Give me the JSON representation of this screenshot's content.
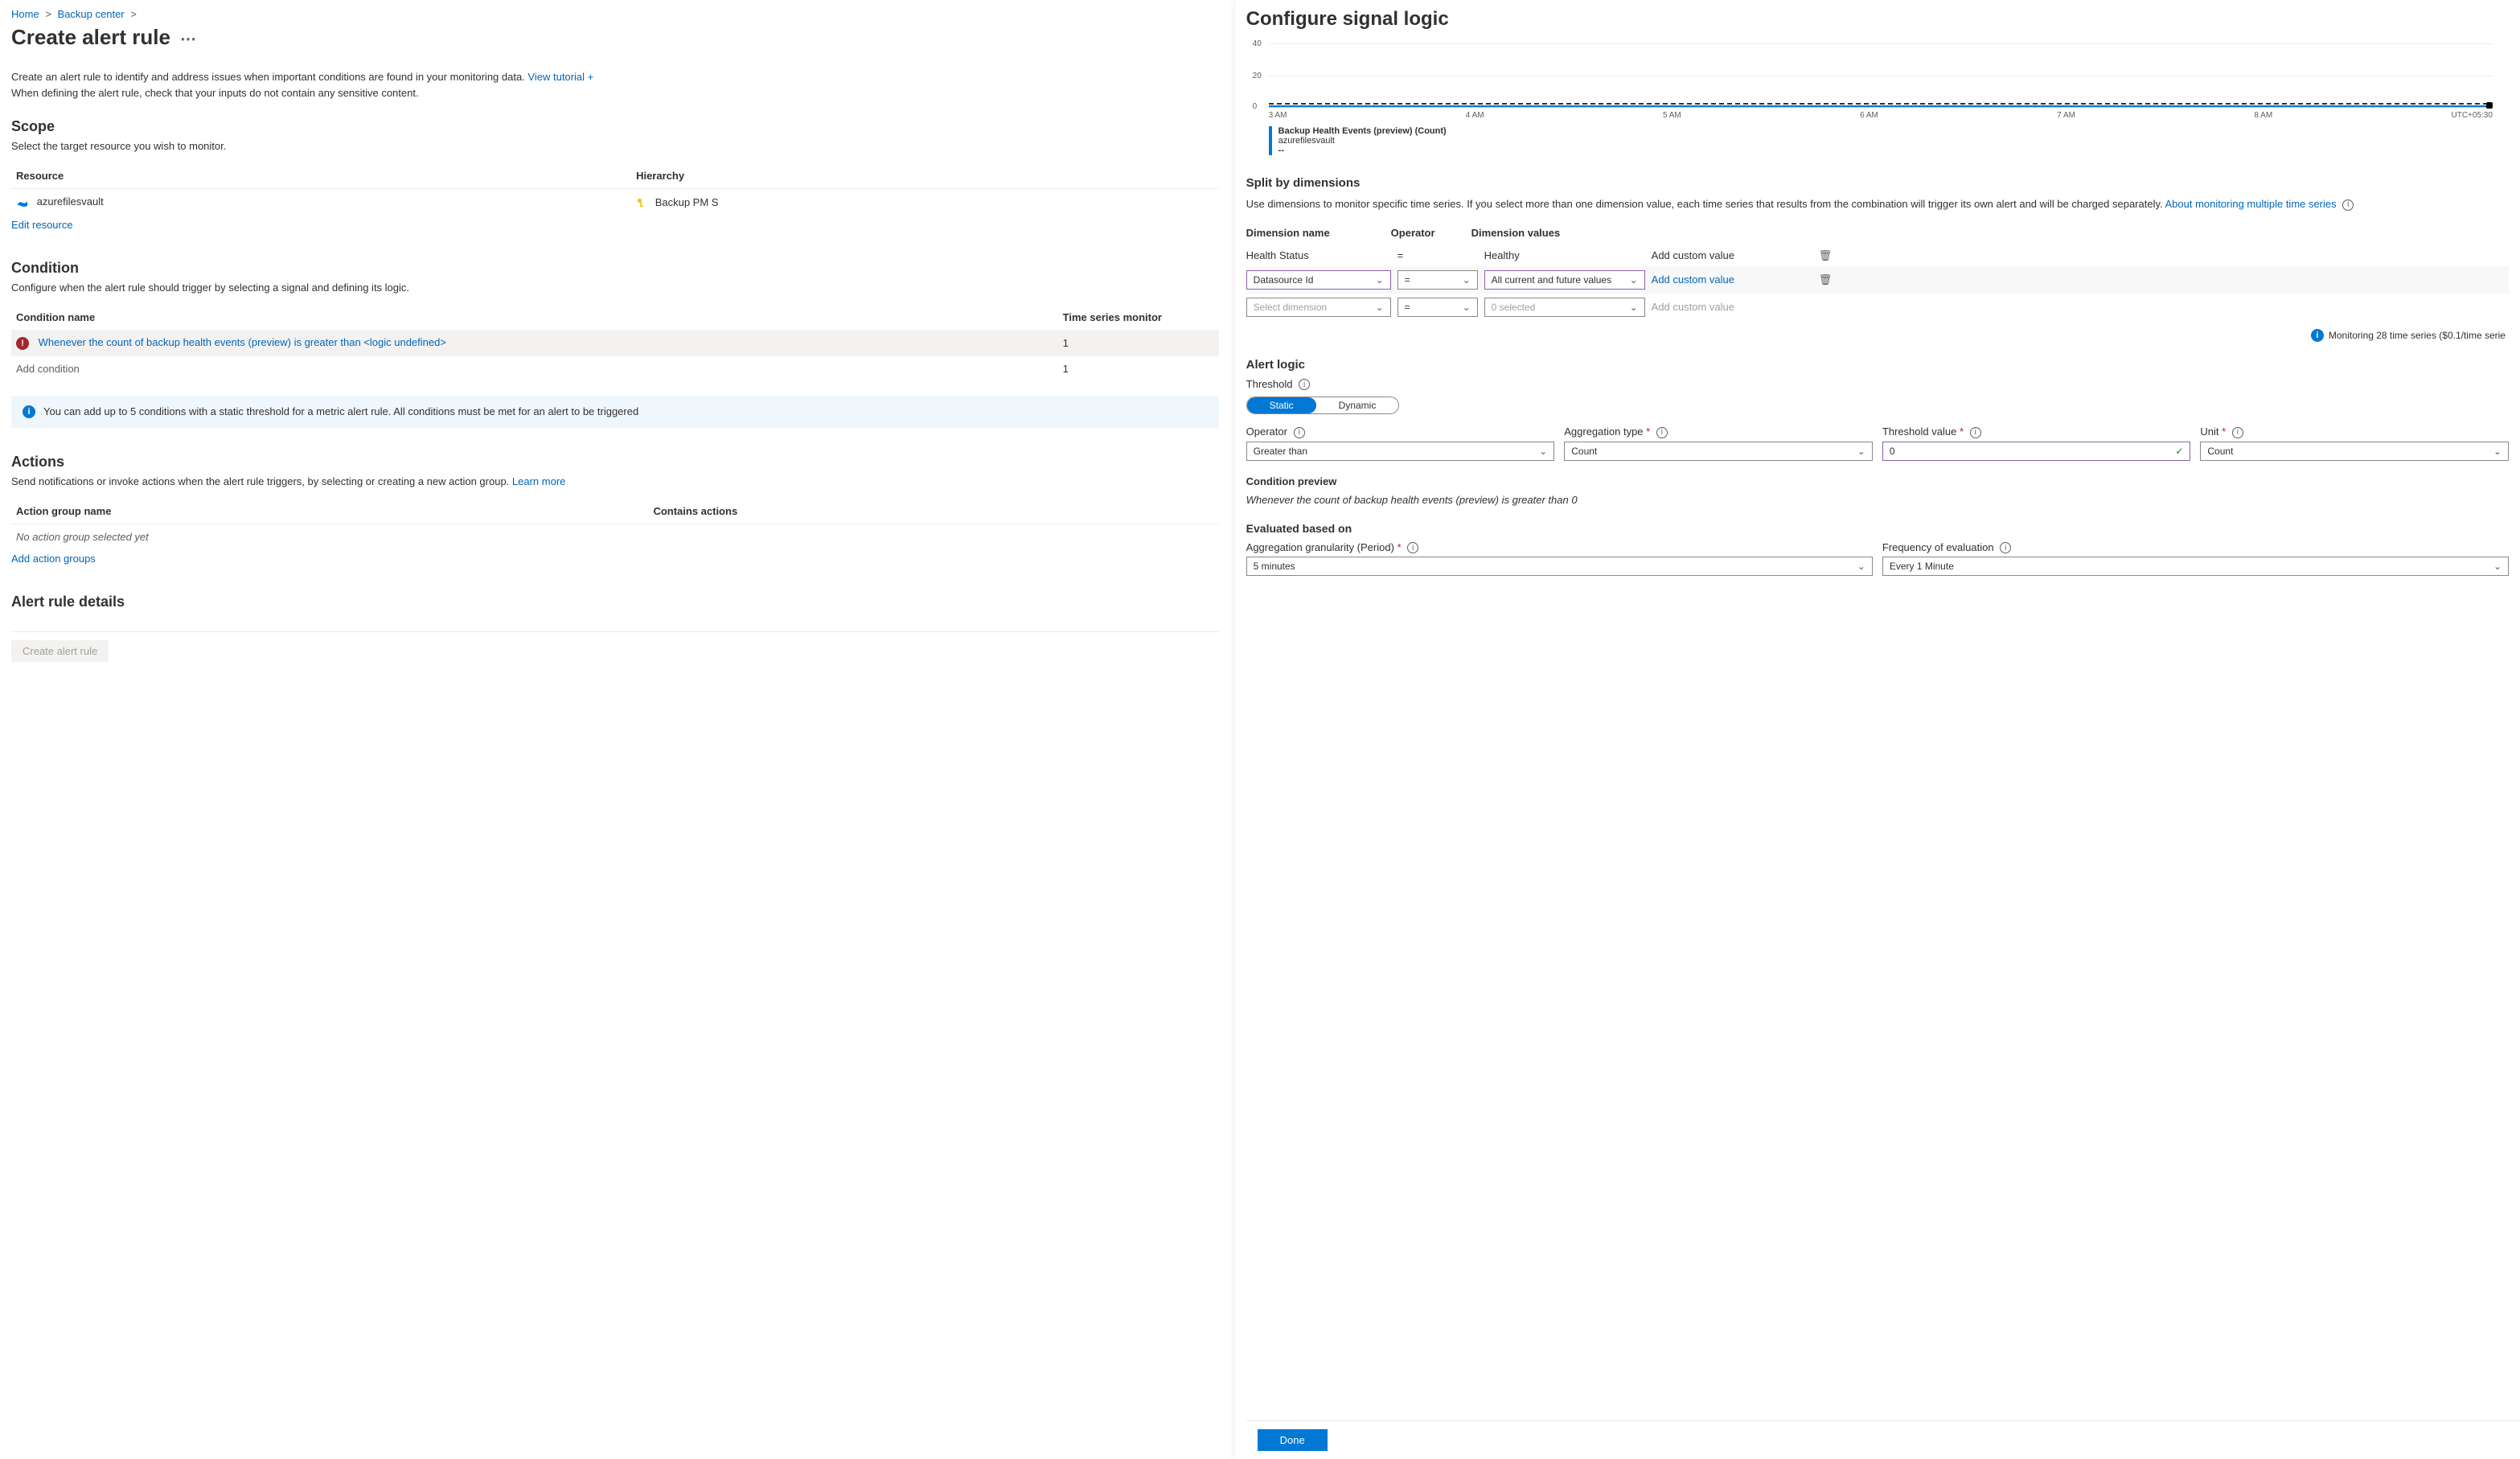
{
  "breadcrumb": {
    "home": "Home",
    "backup_center": "Backup center"
  },
  "page_title": "Create alert rule",
  "intro_text": "Create an alert rule to identify and address issues when important conditions are found in your monitoring data. ",
  "view_tutorial": "View tutorial +",
  "intro_text2": "When defining the alert rule, check that your inputs do not contain any sensitive content.",
  "scope": {
    "heading": "Scope",
    "sub": "Select the target resource you wish to monitor.",
    "col_resource": "Resource",
    "col_hierarchy": "Hierarchy",
    "resource_name": "azurefilesvault",
    "hierarchy_name": "Backup PM S",
    "edit": "Edit resource"
  },
  "condition": {
    "heading": "Condition",
    "sub": "Configure when the alert rule should trigger by selecting a signal and defining its logic.",
    "col_name": "Condition name",
    "col_ts": "Time series monitor",
    "row_name": "Whenever the count of backup health events (preview) is greater than <logic undefined>",
    "row_ts": "1",
    "add": "Add condition",
    "add_ts": "1",
    "info": "You can add up to 5 conditions with a static threshold for a metric alert rule. All conditions must be met for an alert to be triggered"
  },
  "actions": {
    "heading": "Actions",
    "sub_pre": "Send notifications or invoke actions when the alert rule triggers, by selecting or creating a new action group. ",
    "learn": "Learn more",
    "col_name": "Action group name",
    "col_contains": "Contains actions",
    "none": "No action group selected yet",
    "add": "Add action groups"
  },
  "details_heading": "Alert rule details",
  "create_btn": "Create alert rule",
  "rp": {
    "title": "Configure signal logic",
    "y40": "40",
    "y20": "20",
    "y0": "0",
    "x": [
      "3 AM",
      "4 AM",
      "5 AM",
      "6 AM",
      "7 AM",
      "8 AM",
      "UTC+05:30"
    ],
    "legend_title": "Backup Health Events (preview) (Count)",
    "legend_sub": "azurefilesvault",
    "legend_val": "--",
    "split_heading": "Split by dimensions",
    "split_para_pre": "Use dimensions to monitor specific time series. If you select more than one dimension value, each time series that results from the combination will trigger its own alert and will be charged separately. ",
    "split_link": "About monitoring multiple time series",
    "dim_name": "Dimension name",
    "dim_op": "Operator",
    "dim_vals": "Dimension values",
    "r1_name": "Health Status",
    "r1_op": "=",
    "r1_val": "Healthy",
    "r1_add": "Add custom value",
    "r2_name": "Datasource Id",
    "r2_op": "=",
    "r2_val": "All current and future values",
    "r2_add": "Add custom value",
    "r3_name": "Select dimension",
    "r3_op": "=",
    "r3_val": "0 selected",
    "r3_add": "Add custom value",
    "monitoring_note": "Monitoring 28 time series ($0.1/time serie",
    "alert_logic": "Alert logic",
    "threshold_label": "Threshold",
    "static": "Static",
    "dynamic": "Dynamic",
    "operator": "Operator",
    "operator_val": "Greater than",
    "aggtype": "Aggregation type",
    "aggtype_val": "Count",
    "thresh": "Threshold value",
    "thresh_val": "0",
    "unit": "Unit",
    "unit_val": "Count",
    "cond_preview": "Condition preview",
    "cond_preview_text": "Whenever the count of backup health events (preview) is greater than 0",
    "eval_heading": "Evaluated based on",
    "agg_gran": "Aggregation granularity (Period)",
    "agg_gran_val": "5 minutes",
    "freq": "Frequency of evaluation",
    "freq_val": "Every 1 Minute",
    "done": "Done"
  },
  "chart_data": {
    "type": "line",
    "title": "Backup Health Events (preview) (Count)",
    "ylim": [
      0,
      40
    ],
    "x": [
      "3 AM",
      "4 AM",
      "5 AM",
      "6 AM",
      "7 AM",
      "8 AM"
    ],
    "series": [
      {
        "name": "azurefilesvault",
        "values": [
          0,
          0,
          0,
          0,
          0,
          0
        ]
      }
    ]
  }
}
